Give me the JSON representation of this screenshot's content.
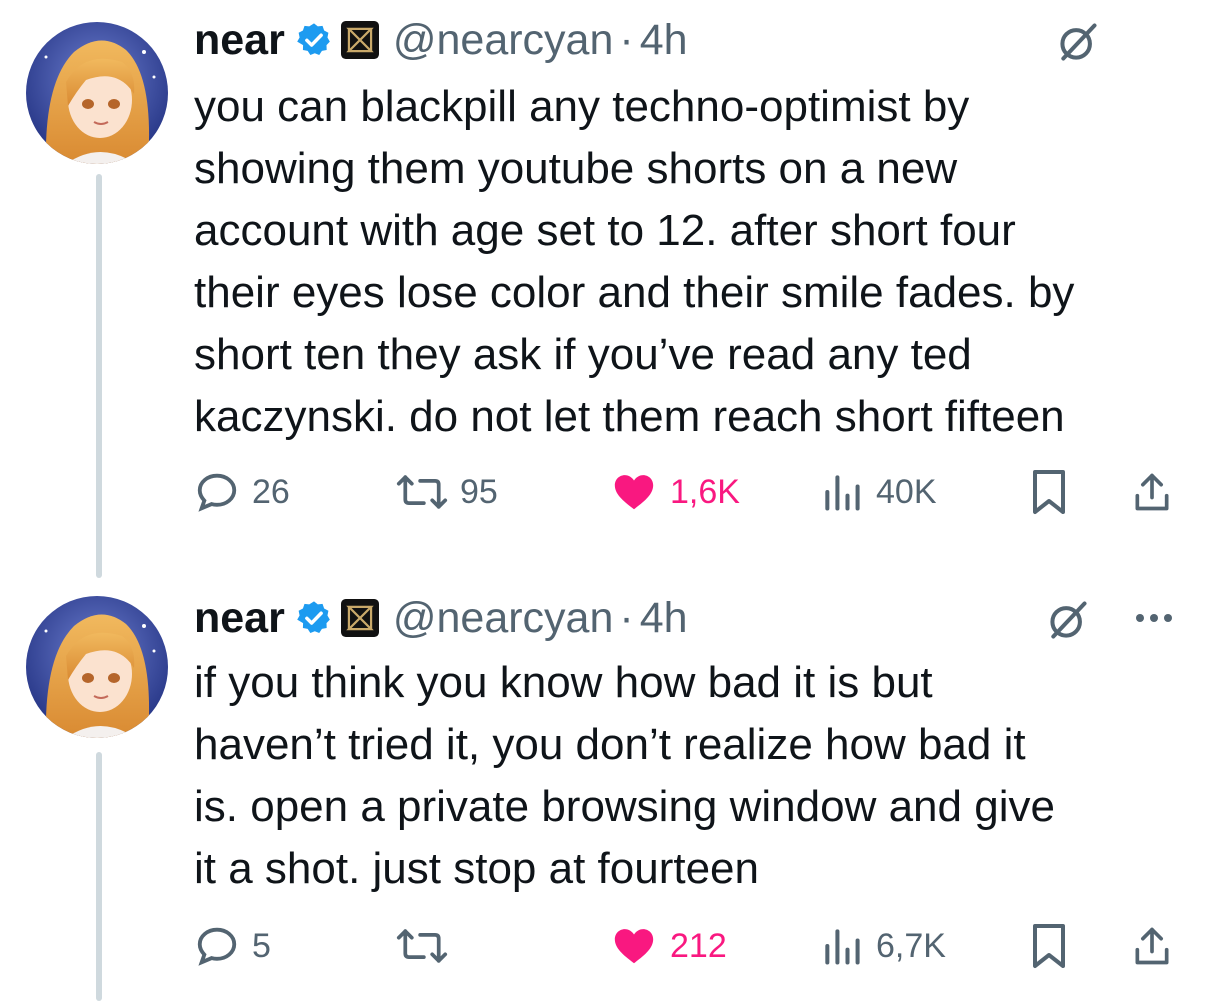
{
  "colors": {
    "text": "#0f1419",
    "secondary": "#536471",
    "verified": "#1d9bf0",
    "like": "#f91880",
    "thread_line": "#cfd9de"
  },
  "tweets": [
    {
      "author": {
        "display_name": "near",
        "handle": "@nearcyan",
        "separator": "·",
        "time": "4h",
        "verified": true,
        "affiliate_badge": "company-badge-icon"
      },
      "text": "you can blackpill any techno-optimist by\nshowing them youtube shorts on a new\naccount with age set to 12. after short four\ntheir eyes lose color and their smile fades. by\nshort ten they ask if you’ve read any ted\nkaczynski. do not let them reach short fifteen",
      "stats": {
        "replies": "26",
        "retweets": "95",
        "likes": "1,6K",
        "views": "40K"
      },
      "liked": true
    },
    {
      "author": {
        "display_name": "near",
        "handle": "@nearcyan",
        "separator": "·",
        "time": "4h",
        "verified": true,
        "affiliate_badge": "company-badge-icon"
      },
      "text": "if you think you know how bad it is but\nhaven’t tried it, you don’t realize how bad it\nis. open a private browsing window and give\nit a shot. just stop at fourteen",
      "stats": {
        "replies": "5",
        "retweets": "",
        "likes": "212",
        "views": "6,7K"
      },
      "liked": true
    }
  ]
}
